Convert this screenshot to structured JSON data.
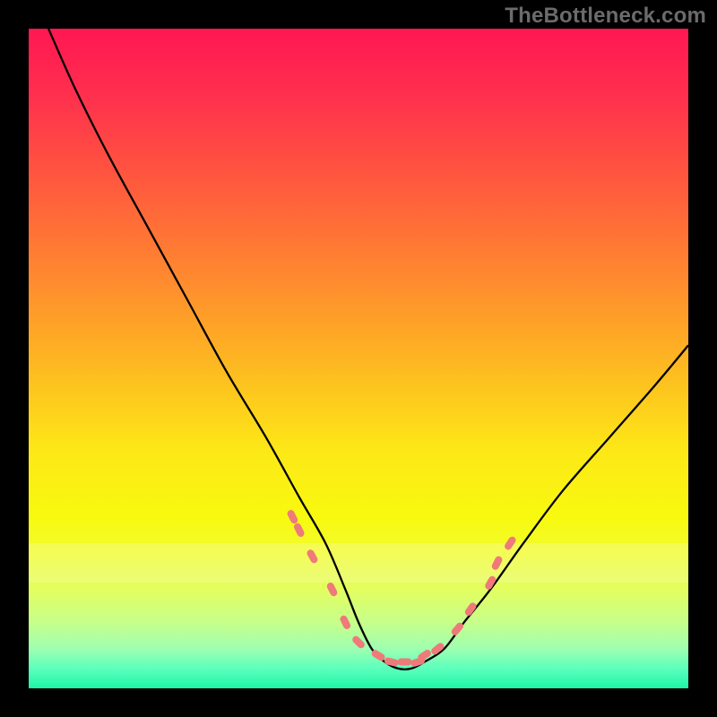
{
  "watermark": "TheBottleneck.com",
  "colors": {
    "background": "#000000",
    "curve": "#000000",
    "marker": "#ef7a7a",
    "gradient_top": "#ff1752",
    "gradient_bottom": "#1ef5a5",
    "stripe": "#fafaf2"
  },
  "chart_data": {
    "type": "line",
    "title": "",
    "xlabel": "",
    "ylabel": "",
    "xlim": [
      0,
      100
    ],
    "ylim": [
      0,
      100
    ],
    "grid": false,
    "curve": {
      "x": [
        3,
        7,
        12,
        18,
        24,
        30,
        36,
        41,
        45,
        48,
        50,
        52,
        54,
        56,
        58,
        60,
        63,
        66,
        70,
        75,
        81,
        88,
        95,
        100
      ],
      "y": [
        100,
        91,
        81,
        70,
        59,
        48,
        38,
        29,
        22,
        15,
        10,
        6,
        4,
        3,
        3,
        4,
        6,
        10,
        15,
        22,
        30,
        38,
        46,
        52
      ]
    },
    "markers": {
      "x": [
        40,
        41,
        43,
        46,
        48,
        50,
        53,
        55,
        57,
        59,
        60,
        62,
        65,
        67,
        70,
        71,
        73
      ],
      "y": [
        26,
        24,
        20,
        15,
        10,
        7,
        5,
        4,
        4,
        4,
        5,
        6,
        9,
        12,
        16,
        19,
        22
      ]
    },
    "stripes": [
      {
        "y": 78,
        "h": 2.5
      },
      {
        "y": 80.5,
        "h": 2.0
      },
      {
        "y": 82.5,
        "h": 1.5
      }
    ],
    "annotations": []
  }
}
